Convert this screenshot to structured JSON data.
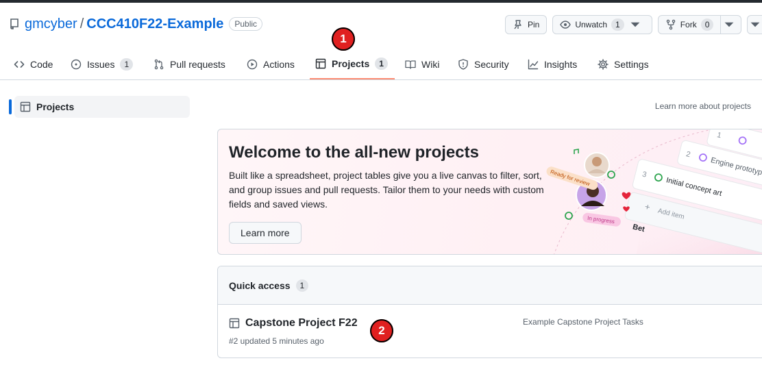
{
  "repo": {
    "owner": "gmcyber",
    "separator": "/",
    "name": "CCC410F22-Example",
    "visibility": "Public"
  },
  "header_actions": {
    "pin_label": "Pin",
    "unwatch_label": "Unwatch",
    "unwatch_count": "1",
    "fork_label": "Fork",
    "fork_count": "0"
  },
  "nav": {
    "tabs": [
      {
        "label": "Code",
        "icon": "code-icon"
      },
      {
        "label": "Issues",
        "icon": "issue-icon",
        "count": "1"
      },
      {
        "label": "Pull requests",
        "icon": "pull-request-icon"
      },
      {
        "label": "Actions",
        "icon": "play-icon"
      },
      {
        "label": "Projects",
        "icon": "table-icon",
        "count": "1",
        "active": true
      },
      {
        "label": "Wiki",
        "icon": "book-icon"
      },
      {
        "label": "Security",
        "icon": "shield-icon"
      },
      {
        "label": "Insights",
        "icon": "graph-icon"
      },
      {
        "label": "Settings",
        "icon": "gear-icon"
      }
    ]
  },
  "markers": {
    "one": "1",
    "two": "2"
  },
  "sidebar": {
    "item_label": "Projects"
  },
  "learn_more_link": "Learn more about projects",
  "welcome": {
    "title": "Welcome to the all-new projects",
    "body": "Built like a spreadsheet, project tables give you a live canvas to filter, sort, and group issues and pull requests. Tailor them to your needs with custom fields and saved views.",
    "button_label": "Learn more",
    "illustration": {
      "tag_ready": "Ready for review",
      "tag_progress": "In progress",
      "rows": [
        {
          "num": "1",
          "text": ""
        },
        {
          "num": "2",
          "text": "Engine prototype"
        },
        {
          "num": "3",
          "text": "Initial concept art"
        }
      ],
      "add_item": "Add item",
      "bottom_text": "Bet"
    }
  },
  "quick_access": {
    "title": "Quick access",
    "count": "1",
    "project": {
      "title": "Capstone Project F22",
      "meta": "#2 updated 5 minutes ago",
      "description": "Example Capstone Project Tasks"
    }
  },
  "colors": {
    "accent": "#0969da",
    "active_tab_underline": "#fd8c73",
    "marker": "#e02020"
  }
}
